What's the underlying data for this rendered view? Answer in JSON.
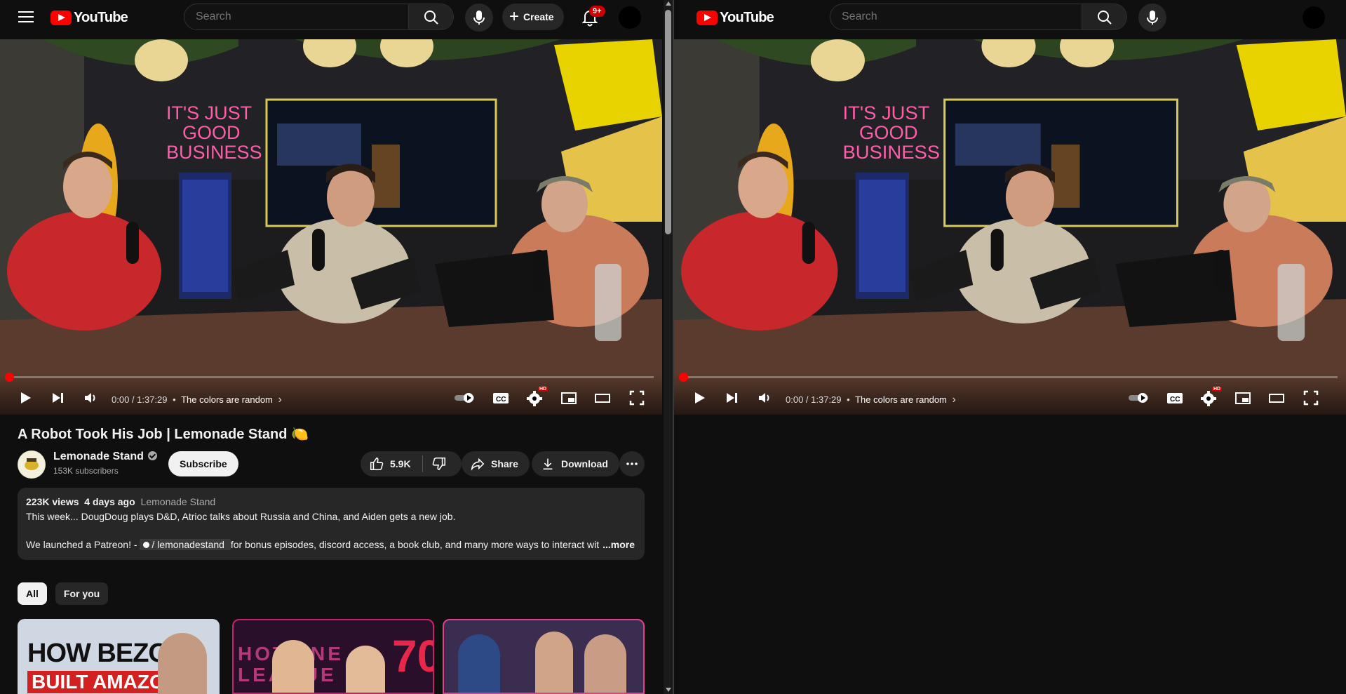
{
  "masthead": {
    "logo_text": "YouTube",
    "search_placeholder": "Search",
    "create_label": "Create",
    "notifications_badge": "9+"
  },
  "player": {
    "time": "0:00 / 1:37:29",
    "separator": "•",
    "chapter": "The colors are random",
    "chapter_chevron": "›",
    "progress_fraction": 0,
    "quality_badge": "HD",
    "scene": {
      "neon_sign": [
        "IT'S JUST",
        "GOOD",
        "BUSINESS"
      ]
    }
  },
  "video": {
    "title": "A Robot Took His Job | Lemonade Stand 🍋",
    "channel_name": "Lemonade Stand",
    "subscribers": "153K subscribers",
    "subscribe_label": "Subscribe",
    "likes": "5.9K",
    "share_label": "Share",
    "download_label": "Download"
  },
  "description": {
    "views": "223K views",
    "age": "4 days ago",
    "tag": "Lemonade Stand",
    "line1": "This week... DougDoug plays D&D, Atrioc talks about Russia and China, and Aiden gets a new job.",
    "line2_prefix": "We launched a Patreon! - ",
    "patreon_link": "/ lemonadestand",
    "line2_suffix": " for bonus episodes, discord access, a book club, and many more ways to interact with",
    "more_label": "...more"
  },
  "chips": [
    "All",
    "For you"
  ],
  "recommendations": [
    {
      "thumb_text_1": "HOW BEZOS",
      "thumb_text_2": "BUILT AMAZON"
    },
    {
      "thumb_text_1": "HOTLINE",
      "thumb_text_2": "LEAGUE",
      "thumb_number": "70"
    },
    {
      "thumb_text_1": ""
    }
  ],
  "colors": {
    "background": "#0f0f0f",
    "accent_red": "#ff0000",
    "chip_bg": "#272727"
  }
}
